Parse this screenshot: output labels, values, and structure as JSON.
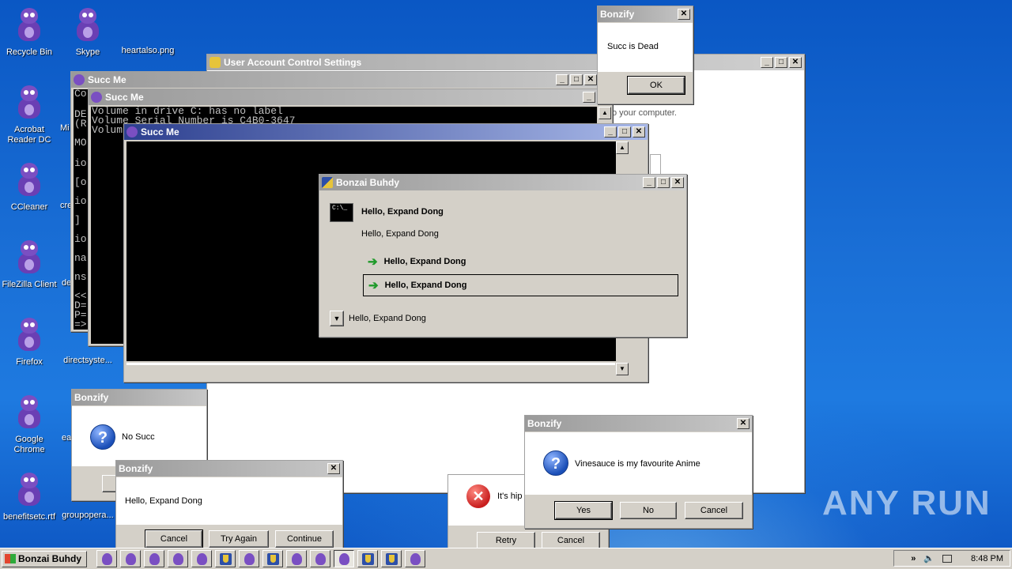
{
  "desktop": {
    "icons": [
      {
        "label": "Recycle Bin"
      },
      {
        "label": "Skype"
      },
      {
        "label": "heartalso.png"
      },
      {
        "label": "Acrobat Reader DC"
      },
      {
        "label": "Mi"
      },
      {
        "label": "CCleaner"
      },
      {
        "label": "cre"
      },
      {
        "label": "FileZilla Client"
      },
      {
        "label": "de"
      },
      {
        "label": "Firefox"
      },
      {
        "label": "directsyste..."
      },
      {
        "label": "Google Chrome"
      },
      {
        "label": "ea"
      },
      {
        "label": "benefitsetc.rtf"
      },
      {
        "label": "groupopera..."
      }
    ]
  },
  "uac_window": {
    "title": "User Account Control Settings",
    "text": "o your computer."
  },
  "succ_back": {
    "title": "Succ Me",
    "left_chars": [
      "Co",
      "DE",
      "(R",
      "MO",
      "io",
      "[o",
      "io",
      "]",
      "io",
      "na",
      "ns",
      "<<",
      "D=",
      "P=",
      "=>"
    ]
  },
  "succ_mid": {
    "title": "Succ Me",
    "lines": [
      "Volume in drive C: has no label",
      "Volume Serial Number is C4B0-3647",
      "Volum"
    ]
  },
  "succ_front": {
    "title": "Succ Me"
  },
  "bonzai_dialog": {
    "title": "Bonzai Buhdy",
    "heading": "Hello, Expand Dong",
    "body": "Hello, Expand Dong",
    "option1": "Hello, Expand Dong",
    "option2": "Hello, Expand Dong",
    "details": "Hello, Expand Dong",
    "cmd_icon_text": "C:\\_"
  },
  "bonzify_dead": {
    "title": "Bonzify",
    "message": "Succ is Dead",
    "ok": "OK"
  },
  "bonzify_nosucc": {
    "title": "Bonzify",
    "message": "No Succ",
    "icon": "?"
  },
  "bonzify_expand": {
    "title": "Bonzify",
    "message": "Hello, Expand Dong",
    "cancel": "Cancel",
    "try_again": "Try Again",
    "continue": "Continue"
  },
  "error_dialog": {
    "message": "It's hip",
    "retry": "Retry",
    "cancel": "Cancel"
  },
  "bonzify_anime": {
    "title": "Bonzify",
    "message": "Vinesauce is my favourite Anime",
    "yes": "Yes",
    "no": "No",
    "cancel": "Cancel",
    "icon": "?"
  },
  "taskbar": {
    "start_label": "Bonzai Buhdy",
    "clock": "8:48 PM",
    "tray_chevron": "»"
  },
  "watermark": "ANY RUN"
}
